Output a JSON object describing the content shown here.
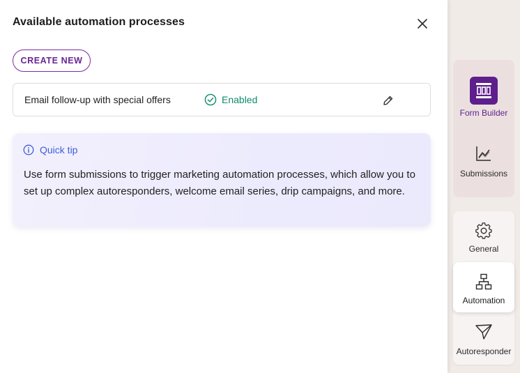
{
  "panel": {
    "title": "Available automation processes",
    "create_label": "CREATE NEW"
  },
  "processes": [
    {
      "name": "Email follow-up with special offers",
      "status": "Enabled"
    }
  ],
  "tip": {
    "title": "Quick tip",
    "text": "Use form submissions to trigger marketing automation processes, which allow you to set up complex autoresponders, welcome email series, drip campaigns, and more."
  },
  "sidebar": {
    "items": [
      {
        "label": "Form Builder",
        "icon": "form-builder-icon"
      },
      {
        "label": "Submissions",
        "icon": "chart-icon"
      },
      {
        "label": "General",
        "icon": "gear-icon"
      },
      {
        "label": "Automation",
        "icon": "workflow-icon"
      },
      {
        "label": "Autoresponder",
        "icon": "paper-plane-icon"
      }
    ]
  },
  "colors": {
    "brand": "#5e1f8c",
    "enabled": "#0f8a6e",
    "tip_accent": "#3d5fd6"
  }
}
